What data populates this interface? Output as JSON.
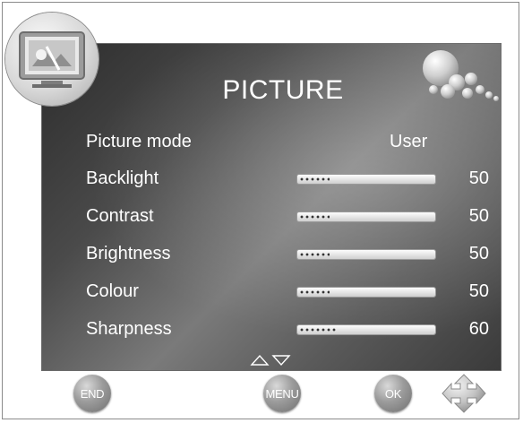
{
  "menu": {
    "title": "PICTURE",
    "rows": [
      {
        "label": "Picture mode",
        "value_text": "User"
      },
      {
        "label": "Backlight",
        "value": 50,
        "value_label": "50"
      },
      {
        "label": "Contrast",
        "value": 50,
        "value_label": "50"
      },
      {
        "label": "Brightness",
        "value": 50,
        "value_label": "50"
      },
      {
        "label": "Colour",
        "value": 50,
        "value_label": "50"
      },
      {
        "label": "Sharpness",
        "value": 60,
        "value_label": "60"
      }
    ]
  },
  "buttons": {
    "end": "END",
    "menu": "MENU",
    "ok": "OK"
  },
  "icons": {
    "badge": "tv-picture-icon",
    "decoration": "bubbles-icon",
    "scroll": "up-down-arrows-icon",
    "navigation": "dpad-icon"
  },
  "colors": {
    "panel_dark": "#2c2c2c",
    "panel_light": "#7a7a7a",
    "text": "#ffffff",
    "button": "#9b9b9b"
  }
}
